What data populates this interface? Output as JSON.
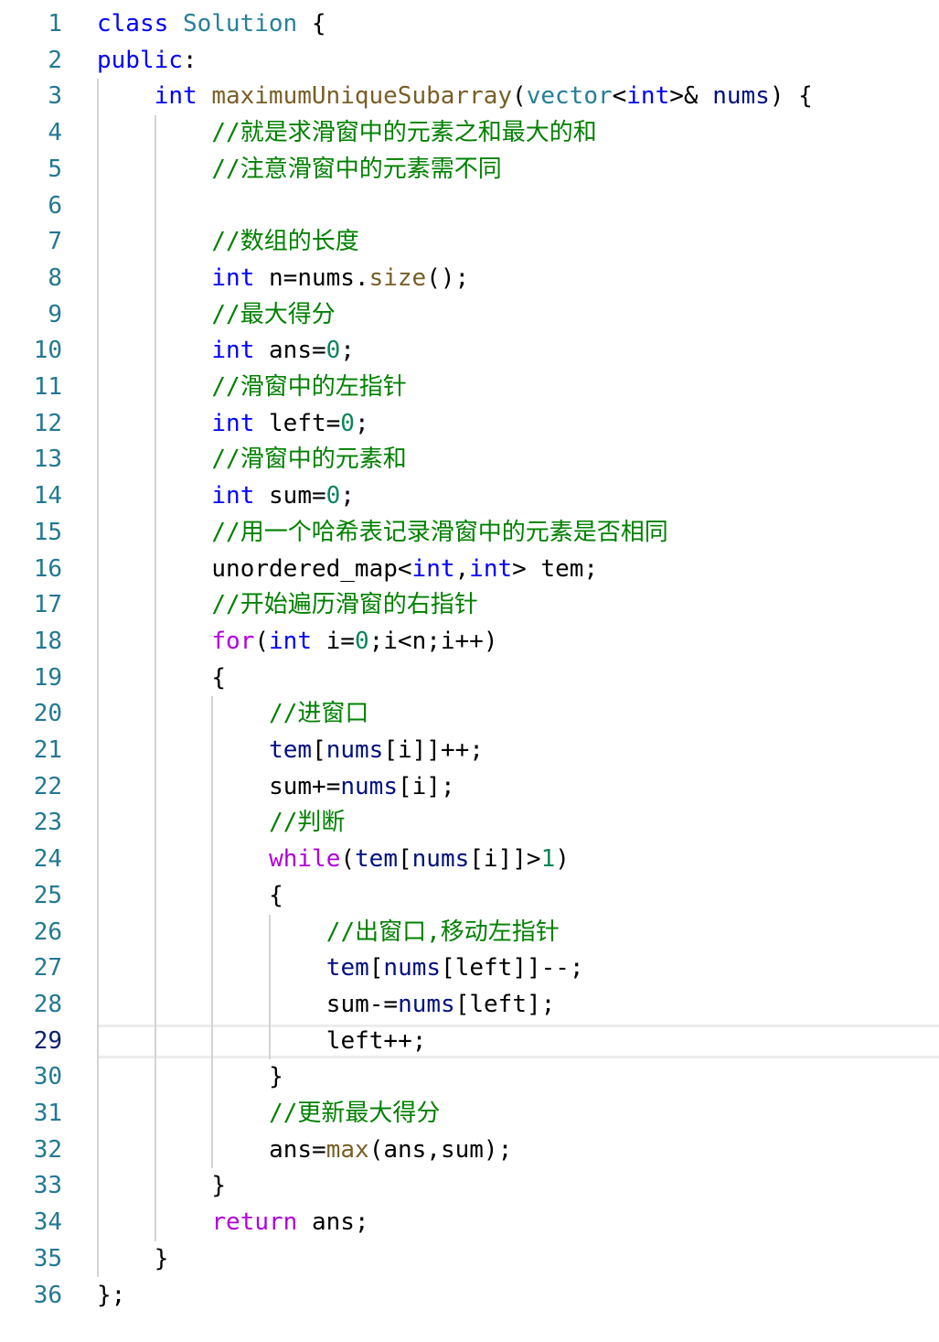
{
  "editor": {
    "current_line": 29,
    "lines": [
      {
        "n": "1",
        "indent": 0,
        "tokens": [
          {
            "t": "class",
            "k": "kw"
          },
          {
            "t": " "
          },
          {
            "t": "Solution",
            "k": "type"
          },
          {
            "t": " {"
          }
        ]
      },
      {
        "n": "2",
        "indent": 0,
        "tokens": [
          {
            "t": "public",
            "k": "kw"
          },
          {
            "t": ":"
          }
        ]
      },
      {
        "n": "3",
        "indent": 1,
        "tokens": [
          {
            "t": "int",
            "k": "kw"
          },
          {
            "t": " "
          },
          {
            "t": "maximumUniqueSubarray",
            "k": "fn"
          },
          {
            "t": "("
          },
          {
            "t": "vector",
            "k": "type"
          },
          {
            "t": "<"
          },
          {
            "t": "int",
            "k": "kw"
          },
          {
            "t": ">& "
          },
          {
            "t": "nums",
            "k": "var"
          },
          {
            "t": ") {"
          }
        ]
      },
      {
        "n": "4",
        "indent": 2,
        "tokens": [
          {
            "t": "//就是求滑窗中的元素之和最大的和",
            "k": "cm"
          }
        ]
      },
      {
        "n": "5",
        "indent": 2,
        "tokens": [
          {
            "t": "//注意滑窗中的元素需不同",
            "k": "cm"
          }
        ]
      },
      {
        "n": "6",
        "indent": 2,
        "tokens": []
      },
      {
        "n": "7",
        "indent": 2,
        "tokens": [
          {
            "t": "//数组的长度",
            "k": "cm"
          }
        ]
      },
      {
        "n": "8",
        "indent": 2,
        "tokens": [
          {
            "t": "int",
            "k": "kw"
          },
          {
            "t": " n=nums."
          },
          {
            "t": "size",
            "k": "fn"
          },
          {
            "t": "();"
          }
        ]
      },
      {
        "n": "9",
        "indent": 2,
        "tokens": [
          {
            "t": "//最大得分",
            "k": "cm"
          }
        ]
      },
      {
        "n": "10",
        "indent": 2,
        "tokens": [
          {
            "t": "int",
            "k": "kw"
          },
          {
            "t": " ans="
          },
          {
            "t": "0",
            "k": "num"
          },
          {
            "t": ";"
          }
        ]
      },
      {
        "n": "11",
        "indent": 2,
        "tokens": [
          {
            "t": "//滑窗中的左指针",
            "k": "cm"
          }
        ]
      },
      {
        "n": "12",
        "indent": 2,
        "tokens": [
          {
            "t": "int",
            "k": "kw"
          },
          {
            "t": " left="
          },
          {
            "t": "0",
            "k": "num"
          },
          {
            "t": ";"
          }
        ]
      },
      {
        "n": "13",
        "indent": 2,
        "tokens": [
          {
            "t": "//滑窗中的元素和",
            "k": "cm"
          }
        ]
      },
      {
        "n": "14",
        "indent": 2,
        "tokens": [
          {
            "t": "int",
            "k": "kw"
          },
          {
            "t": " sum="
          },
          {
            "t": "0",
            "k": "num"
          },
          {
            "t": ";"
          }
        ]
      },
      {
        "n": "15",
        "indent": 2,
        "tokens": [
          {
            "t": "//用一个哈希表记录滑窗中的元素是否相同",
            "k": "cm"
          }
        ]
      },
      {
        "n": "16",
        "indent": 2,
        "tokens": [
          {
            "t": "unordered_map<"
          },
          {
            "t": "int",
            "k": "kw"
          },
          {
            "t": ","
          },
          {
            "t": "int",
            "k": "kw"
          },
          {
            "t": "> tem;"
          }
        ]
      },
      {
        "n": "17",
        "indent": 2,
        "tokens": [
          {
            "t": "//开始遍历滑窗的右指针",
            "k": "cm"
          }
        ]
      },
      {
        "n": "18",
        "indent": 2,
        "tokens": [
          {
            "t": "for",
            "k": "ctrl"
          },
          {
            "t": "("
          },
          {
            "t": "int",
            "k": "kw"
          },
          {
            "t": " i="
          },
          {
            "t": "0",
            "k": "num"
          },
          {
            "t": ";i<n;i++)"
          }
        ]
      },
      {
        "n": "19",
        "indent": 2,
        "tokens": [
          {
            "t": "{"
          }
        ]
      },
      {
        "n": "20",
        "indent": 3,
        "tokens": [
          {
            "t": "//进窗口",
            "k": "cm"
          }
        ]
      },
      {
        "n": "21",
        "indent": 3,
        "tokens": [
          {
            "t": "tem",
            "k": "var"
          },
          {
            "t": "["
          },
          {
            "t": "nums",
            "k": "var"
          },
          {
            "t": "[i]]++;"
          }
        ]
      },
      {
        "n": "22",
        "indent": 3,
        "tokens": [
          {
            "t": "sum+="
          },
          {
            "t": "nums",
            "k": "var"
          },
          {
            "t": "[i];"
          }
        ]
      },
      {
        "n": "23",
        "indent": 3,
        "tokens": [
          {
            "t": "//判断",
            "k": "cm"
          }
        ]
      },
      {
        "n": "24",
        "indent": 3,
        "tokens": [
          {
            "t": "while",
            "k": "ctrl"
          },
          {
            "t": "("
          },
          {
            "t": "tem",
            "k": "var"
          },
          {
            "t": "["
          },
          {
            "t": "nums",
            "k": "var"
          },
          {
            "t": "[i]]>"
          },
          {
            "t": "1",
            "k": "num"
          },
          {
            "t": ")"
          }
        ]
      },
      {
        "n": "25",
        "indent": 3,
        "tokens": [
          {
            "t": "{"
          }
        ]
      },
      {
        "n": "26",
        "indent": 4,
        "tokens": [
          {
            "t": "//出窗口,移动左指针",
            "k": "cm"
          }
        ]
      },
      {
        "n": "27",
        "indent": 4,
        "tokens": [
          {
            "t": "tem",
            "k": "var"
          },
          {
            "t": "["
          },
          {
            "t": "nums",
            "k": "var"
          },
          {
            "t": "[left]]--;"
          }
        ]
      },
      {
        "n": "28",
        "indent": 4,
        "tokens": [
          {
            "t": "sum-="
          },
          {
            "t": "nums",
            "k": "var"
          },
          {
            "t": "[left];"
          }
        ]
      },
      {
        "n": "29",
        "indent": 4,
        "tokens": [
          {
            "t": "left++;"
          }
        ]
      },
      {
        "n": "30",
        "indent": 3,
        "tokens": [
          {
            "t": "}"
          }
        ]
      },
      {
        "n": "31",
        "indent": 3,
        "tokens": [
          {
            "t": "//更新最大得分",
            "k": "cm"
          }
        ]
      },
      {
        "n": "32",
        "indent": 3,
        "tokens": [
          {
            "t": "ans="
          },
          {
            "t": "max",
            "k": "fn"
          },
          {
            "t": "(ans,sum);"
          }
        ]
      },
      {
        "n": "33",
        "indent": 2,
        "tokens": [
          {
            "t": "}"
          }
        ]
      },
      {
        "n": "34",
        "indent": 2,
        "tokens": [
          {
            "t": "return",
            "k": "ctrl"
          },
          {
            "t": " ans;"
          }
        ]
      },
      {
        "n": "35",
        "indent": 1,
        "tokens": [
          {
            "t": "}"
          }
        ]
      },
      {
        "n": "36",
        "indent": 0,
        "tokens": [
          {
            "t": "};"
          }
        ]
      }
    ]
  }
}
